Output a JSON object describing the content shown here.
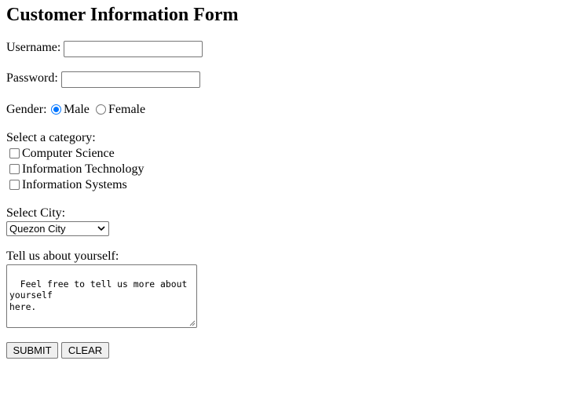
{
  "form": {
    "title": "Customer Information Form",
    "username": {
      "label": "Username:",
      "value": ""
    },
    "password": {
      "label": "Password:",
      "value": ""
    },
    "gender": {
      "label": "Gender:",
      "options": [
        "Male",
        "Female"
      ],
      "selected": "Male"
    },
    "category": {
      "label": "Select a category:",
      "options": [
        "Computer Science",
        "Information Technology",
        "Information Systems"
      ]
    },
    "city": {
      "label": "Select City:",
      "selected": "Quezon City"
    },
    "about": {
      "label": "Tell us about yourself:",
      "value": "Feel free to tell us more about\nyourself\nhere."
    },
    "buttons": {
      "submit": "SUBMIT",
      "clear": "CLEAR"
    }
  },
  "icons": {
    "select_arrow": "chevron-down-icon",
    "textarea_grip": "resize-grip-icon"
  },
  "colors": {
    "accent": "#0075ff",
    "border": "#767676",
    "button_bg": "#efefef"
  }
}
